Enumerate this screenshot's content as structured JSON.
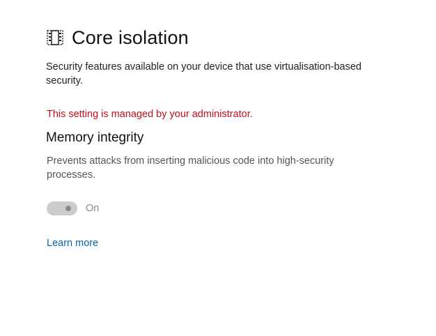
{
  "header": {
    "icon": "core-isolation-chip-icon",
    "title": "Core isolation"
  },
  "description": "Security features available on your device that use virtualisation-based security.",
  "managed_notice": "This setting is managed by your administrator.",
  "memory_integrity": {
    "title": "Memory integrity",
    "description": "Prevents attacks from inserting malicious code into high-security processes.",
    "toggle": {
      "state": "On",
      "enabled": false
    }
  },
  "learn_more_link": "Learn more",
  "colors": {
    "managed_notice": "#c50f1f",
    "link": "#0063b1",
    "toggle_disabled": "#cccccc"
  }
}
